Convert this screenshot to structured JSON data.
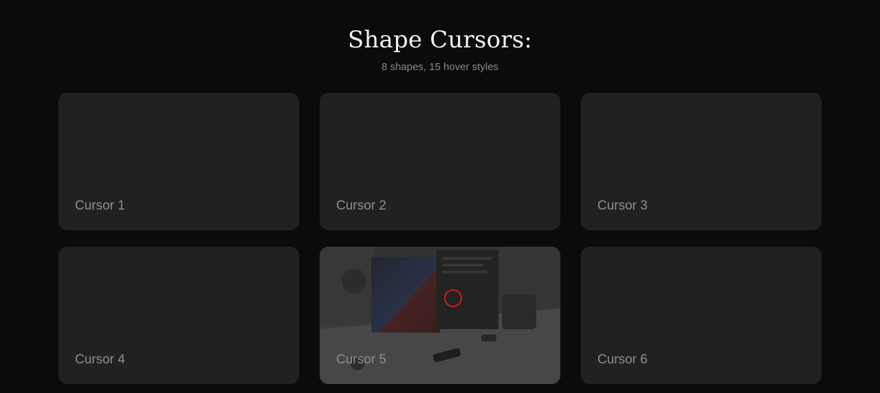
{
  "header": {
    "title": "Shape Cursors:",
    "subtitle": "8 shapes, 15 hover styles"
  },
  "cards": [
    {
      "label": "Cursor 1"
    },
    {
      "label": "Cursor 2"
    },
    {
      "label": "Cursor 3"
    },
    {
      "label": "Cursor 4"
    },
    {
      "label": "Cursor 5"
    },
    {
      "label": "Cursor 6"
    }
  ],
  "colors": {
    "background": "#0b0b0b",
    "card": "#212121",
    "cursor_ring": "#d51a1a",
    "title": "#f2f2f2",
    "muted_text": "#8e8e8e"
  },
  "hover_state": {
    "hovered_card_index": 4,
    "cursor_shape": "circle-outline-icon"
  }
}
